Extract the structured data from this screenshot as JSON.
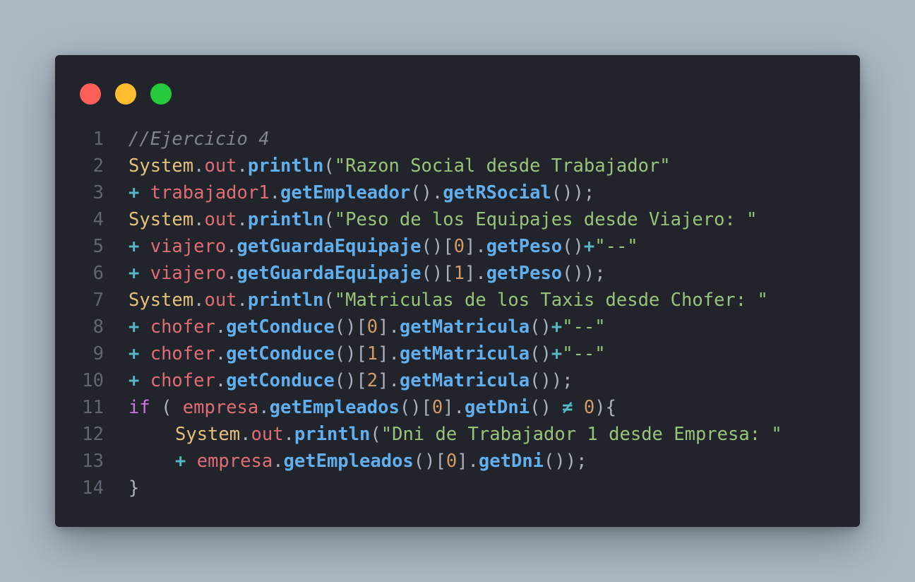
{
  "window": {
    "controls": [
      {
        "name": "close",
        "color": "#ff5f56"
      },
      {
        "name": "minimize",
        "color": "#ffbd2e"
      },
      {
        "name": "maximize",
        "color": "#27c93f"
      }
    ]
  },
  "code": {
    "lines": [
      {
        "n": "1",
        "indent": 0,
        "tokens": [
          {
            "t": "//Ejercicio 4",
            "k": "c"
          }
        ]
      },
      {
        "n": "2",
        "indent": 0,
        "tokens": [
          {
            "t": "System",
            "k": "cls"
          },
          {
            "t": ".",
            "k": "pn"
          },
          {
            "t": "out",
            "k": "vr"
          },
          {
            "t": ".",
            "k": "pn"
          },
          {
            "t": "println",
            "k": "fn"
          },
          {
            "t": "(",
            "k": "pn"
          },
          {
            "t": "\"Razon Social desde Trabajador\"",
            "k": "st"
          }
        ]
      },
      {
        "n": "3",
        "indent": 0,
        "tokens": [
          {
            "t": "+",
            "k": "op"
          },
          {
            "t": " ",
            "k": "pn"
          },
          {
            "t": "trabajador1",
            "k": "vr"
          },
          {
            "t": ".",
            "k": "pn"
          },
          {
            "t": "getEmpleador",
            "k": "fn"
          },
          {
            "t": "().",
            "k": "pn"
          },
          {
            "t": "getRSocial",
            "k": "fn"
          },
          {
            "t": "());",
            "k": "pn"
          }
        ]
      },
      {
        "n": "4",
        "indent": 0,
        "tokens": [
          {
            "t": "System",
            "k": "cls"
          },
          {
            "t": ".",
            "k": "pn"
          },
          {
            "t": "out",
            "k": "vr"
          },
          {
            "t": ".",
            "k": "pn"
          },
          {
            "t": "println",
            "k": "fn"
          },
          {
            "t": "(",
            "k": "pn"
          },
          {
            "t": "\"Peso de los Equipajes desde Viajero: \"",
            "k": "st"
          }
        ]
      },
      {
        "n": "5",
        "indent": 0,
        "tokens": [
          {
            "t": "+",
            "k": "op"
          },
          {
            "t": " ",
            "k": "pn"
          },
          {
            "t": "viajero",
            "k": "vr"
          },
          {
            "t": ".",
            "k": "pn"
          },
          {
            "t": "getGuardaEquipaje",
            "k": "fn"
          },
          {
            "t": "()[",
            "k": "pn"
          },
          {
            "t": "0",
            "k": "nm"
          },
          {
            "t": "].",
            "k": "pn"
          },
          {
            "t": "getPeso",
            "k": "fn"
          },
          {
            "t": "()",
            "k": "pn"
          },
          {
            "t": "+",
            "k": "op"
          },
          {
            "t": "\"--\"",
            "k": "st"
          }
        ]
      },
      {
        "n": "6",
        "indent": 0,
        "tokens": [
          {
            "t": "+",
            "k": "op"
          },
          {
            "t": " ",
            "k": "pn"
          },
          {
            "t": "viajero",
            "k": "vr"
          },
          {
            "t": ".",
            "k": "pn"
          },
          {
            "t": "getGuardaEquipaje",
            "k": "fn"
          },
          {
            "t": "()[",
            "k": "pn"
          },
          {
            "t": "1",
            "k": "nm"
          },
          {
            "t": "].",
            "k": "pn"
          },
          {
            "t": "getPeso",
            "k": "fn"
          },
          {
            "t": "());",
            "k": "pn"
          }
        ]
      },
      {
        "n": "7",
        "indent": 0,
        "tokens": [
          {
            "t": "System",
            "k": "cls"
          },
          {
            "t": ".",
            "k": "pn"
          },
          {
            "t": "out",
            "k": "vr"
          },
          {
            "t": ".",
            "k": "pn"
          },
          {
            "t": "println",
            "k": "fn"
          },
          {
            "t": "(",
            "k": "pn"
          },
          {
            "t": "\"Matriculas de los Taxis desde Chofer: \"",
            "k": "st"
          }
        ]
      },
      {
        "n": "8",
        "indent": 0,
        "tokens": [
          {
            "t": "+",
            "k": "op"
          },
          {
            "t": " ",
            "k": "pn"
          },
          {
            "t": "chofer",
            "k": "vr"
          },
          {
            "t": ".",
            "k": "pn"
          },
          {
            "t": "getConduce",
            "k": "fn"
          },
          {
            "t": "()[",
            "k": "pn"
          },
          {
            "t": "0",
            "k": "nm"
          },
          {
            "t": "].",
            "k": "pn"
          },
          {
            "t": "getMatricula",
            "k": "fn"
          },
          {
            "t": "()",
            "k": "pn"
          },
          {
            "t": "+",
            "k": "op"
          },
          {
            "t": "\"--\"",
            "k": "st"
          }
        ]
      },
      {
        "n": "9",
        "indent": 0,
        "tokens": [
          {
            "t": "+",
            "k": "op"
          },
          {
            "t": " ",
            "k": "pn"
          },
          {
            "t": "chofer",
            "k": "vr"
          },
          {
            "t": ".",
            "k": "pn"
          },
          {
            "t": "getConduce",
            "k": "fn"
          },
          {
            "t": "()[",
            "k": "pn"
          },
          {
            "t": "1",
            "k": "nm"
          },
          {
            "t": "].",
            "k": "pn"
          },
          {
            "t": "getMatricula",
            "k": "fn"
          },
          {
            "t": "()",
            "k": "pn"
          },
          {
            "t": "+",
            "k": "op"
          },
          {
            "t": "\"--\"",
            "k": "st"
          }
        ]
      },
      {
        "n": "10",
        "indent": 0,
        "tokens": [
          {
            "t": "+",
            "k": "op"
          },
          {
            "t": " ",
            "k": "pn"
          },
          {
            "t": "chofer",
            "k": "vr"
          },
          {
            "t": ".",
            "k": "pn"
          },
          {
            "t": "getConduce",
            "k": "fn"
          },
          {
            "t": "()[",
            "k": "pn"
          },
          {
            "t": "2",
            "k": "nm"
          },
          {
            "t": "].",
            "k": "pn"
          },
          {
            "t": "getMatricula",
            "k": "fn"
          },
          {
            "t": "());",
            "k": "pn"
          }
        ]
      },
      {
        "n": "11",
        "indent": 0,
        "tokens": [
          {
            "t": "if",
            "k": "kw"
          },
          {
            "t": " ( ",
            "k": "pn"
          },
          {
            "t": "empresa",
            "k": "vr"
          },
          {
            "t": ".",
            "k": "pn"
          },
          {
            "t": "getEmpleados",
            "k": "fn"
          },
          {
            "t": "()[",
            "k": "pn"
          },
          {
            "t": "0",
            "k": "nm"
          },
          {
            "t": "].",
            "k": "pn"
          },
          {
            "t": "getDni",
            "k": "fn"
          },
          {
            "t": "() ",
            "k": "pn"
          },
          {
            "t": "≠",
            "k": "op"
          },
          {
            "t": " ",
            "k": "pn"
          },
          {
            "t": "0",
            "k": "nm"
          },
          {
            "t": "){",
            "k": "pn"
          }
        ]
      },
      {
        "n": "12",
        "indent": 1,
        "tokens": [
          {
            "t": "System",
            "k": "cls"
          },
          {
            "t": ".",
            "k": "pn"
          },
          {
            "t": "out",
            "k": "vr"
          },
          {
            "t": ".",
            "k": "pn"
          },
          {
            "t": "println",
            "k": "fn"
          },
          {
            "t": "(",
            "k": "pn"
          },
          {
            "t": "\"Dni de Trabajador 1 desde Empresa: \"",
            "k": "st"
          }
        ]
      },
      {
        "n": "13",
        "indent": 1,
        "tokens": [
          {
            "t": "+",
            "k": "op"
          },
          {
            "t": " ",
            "k": "pn"
          },
          {
            "t": "empresa",
            "k": "vr"
          },
          {
            "t": ".",
            "k": "pn"
          },
          {
            "t": "getEmpleados",
            "k": "fn"
          },
          {
            "t": "()[",
            "k": "pn"
          },
          {
            "t": "0",
            "k": "nm"
          },
          {
            "t": "].",
            "k": "pn"
          },
          {
            "t": "getDni",
            "k": "fn"
          },
          {
            "t": "());",
            "k": "pn"
          }
        ]
      },
      {
        "n": "14",
        "indent": 0,
        "tokens": [
          {
            "t": "}",
            "k": "pn"
          }
        ]
      }
    ]
  }
}
